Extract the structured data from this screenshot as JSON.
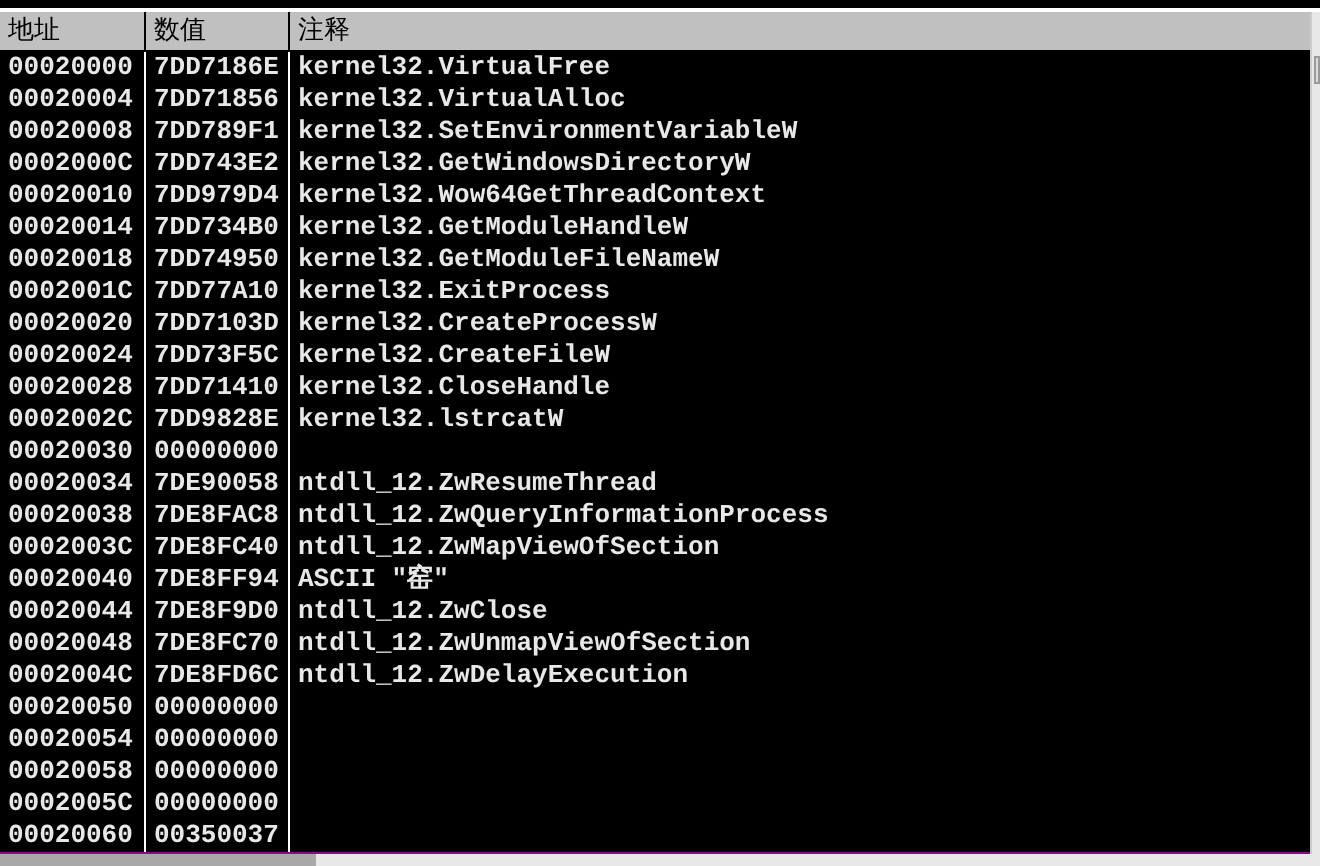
{
  "table": {
    "columns": [
      "地址",
      "数值",
      "注释"
    ],
    "rows": [
      {
        "address": "00020000",
        "value": "7DD7186E",
        "comment": "kernel32.VirtualFree"
      },
      {
        "address": "00020004",
        "value": "7DD71856",
        "comment": "kernel32.VirtualAlloc"
      },
      {
        "address": "00020008",
        "value": "7DD789F1",
        "comment": "kernel32.SetEnvironmentVariableW"
      },
      {
        "address": "0002000C",
        "value": "7DD743E2",
        "comment": "kernel32.GetWindowsDirectoryW"
      },
      {
        "address": "00020010",
        "value": "7DD979D4",
        "comment": "kernel32.Wow64GetThreadContext"
      },
      {
        "address": "00020014",
        "value": "7DD734B0",
        "comment": "kernel32.GetModuleHandleW"
      },
      {
        "address": "00020018",
        "value": "7DD74950",
        "comment": "kernel32.GetModuleFileNameW"
      },
      {
        "address": "0002001C",
        "value": "7DD77A10",
        "comment": "kernel32.ExitProcess"
      },
      {
        "address": "00020020",
        "value": "7DD7103D",
        "comment": "kernel32.CreateProcessW"
      },
      {
        "address": "00020024",
        "value": "7DD73F5C",
        "comment": "kernel32.CreateFileW"
      },
      {
        "address": "00020028",
        "value": "7DD71410",
        "comment": "kernel32.CloseHandle"
      },
      {
        "address": "0002002C",
        "value": "7DD9828E",
        "comment": "kernel32.lstrcatW"
      },
      {
        "address": "00020030",
        "value": "00000000"
      },
      {
        "address": "00020034",
        "value": "7DE90058",
        "comment": "ntdll_12.ZwResumeThread"
      },
      {
        "address": "00020038",
        "value": "7DE8FAC8",
        "comment": "ntdll_12.ZwQueryInformationProcess"
      },
      {
        "address": "0002003C",
        "value": "7DE8FC40",
        "comment": "ntdll_12.ZwMapViewOfSection"
      },
      {
        "address": "00020040",
        "value": "7DE8FF94",
        "comment": "ASCII \"窑\""
      },
      {
        "address": "00020044",
        "value": "7DE8F9D0",
        "comment": "ntdll_12.ZwClose"
      },
      {
        "address": "00020048",
        "value": "7DE8FC70",
        "comment": "ntdll_12.ZwUnmapViewOfSection"
      },
      {
        "address": "0002004C",
        "value": "7DE8FD6C",
        "comment": "ntdll_12.ZwDelayExecution"
      },
      {
        "address": "00020050",
        "value": "00000000"
      },
      {
        "address": "00020054",
        "value": "00000000"
      },
      {
        "address": "00020058",
        "value": "00000000"
      },
      {
        "address": "0002005C",
        "value": "00000000"
      },
      {
        "address": "00020060",
        "value": "00350037"
      }
    ]
  }
}
